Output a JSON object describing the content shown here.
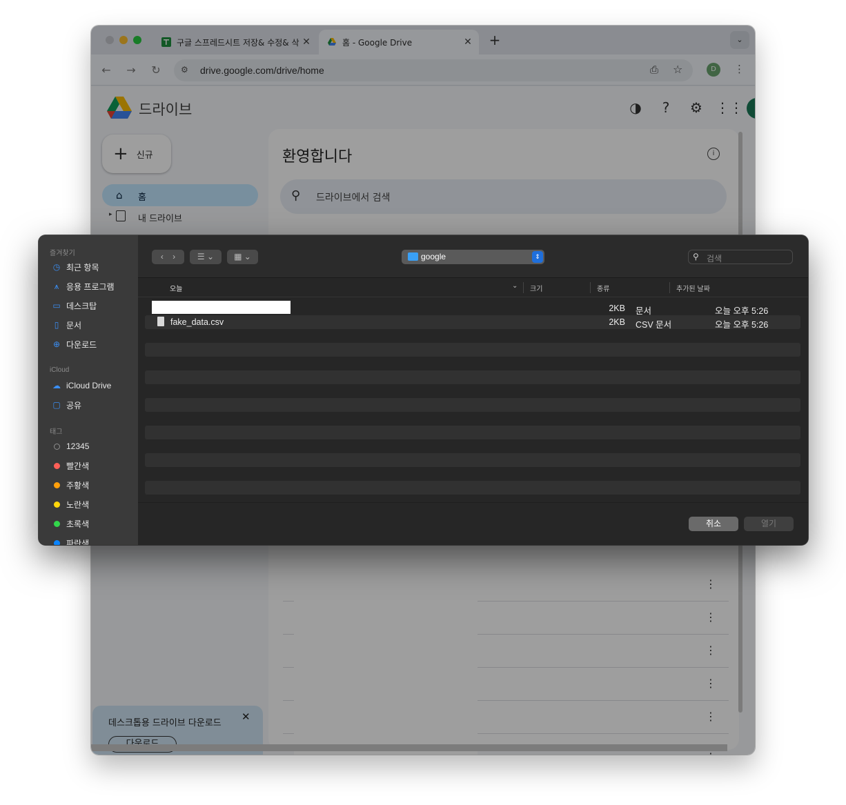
{
  "browser": {
    "tabs": [
      {
        "title": "구글 스프레드시트 저장& 수정& 삭"
      },
      {
        "title": "홈 - Google Drive"
      }
    ],
    "new_tab": "+",
    "url": "drive.google.com/drive/home",
    "profile_initial": "D"
  },
  "drive": {
    "app_name": "드라이브",
    "new_button": "신규",
    "nav": [
      {
        "label": "홈"
      },
      {
        "label": "내 드라이브"
      }
    ],
    "welcome": "환영합니다",
    "search_placeholder": "드라이브에서 검색",
    "promo_title": "데스크톱용 드라이브 다운로드",
    "promo_button": "다운로드"
  },
  "dialog": {
    "sidebar": {
      "favorites_header": "즐겨찾기",
      "favorites": [
        {
          "label": "최근 항목",
          "icon": "clock-icon"
        },
        {
          "label": "응용 프로그램",
          "icon": "apps-icon"
        },
        {
          "label": "데스크탑",
          "icon": "desktop-icon"
        },
        {
          "label": "문서",
          "icon": "document-icon"
        },
        {
          "label": "다운로드",
          "icon": "download-icon"
        }
      ],
      "icloud_header": "iCloud",
      "icloud": [
        {
          "label": "iCloud Drive",
          "icon": "cloud-icon"
        },
        {
          "label": "공유",
          "icon": "shared-folder-icon"
        }
      ],
      "tags_header": "태그",
      "tags": [
        {
          "label": "12345",
          "color": "#8e8e8e"
        },
        {
          "label": "빨간색",
          "color": "#ff5f57"
        },
        {
          "label": "주황색",
          "color": "#ff9f0a"
        },
        {
          "label": "노란색",
          "color": "#ffd60a"
        },
        {
          "label": "초록색",
          "color": "#32d74b"
        },
        {
          "label": "파란색",
          "color": "#0a84ff"
        }
      ]
    },
    "location": "google",
    "search_placeholder": "검색",
    "columns": {
      "name": "오늘",
      "size": "크기",
      "kind": "종류",
      "date": "추가된 날짜"
    },
    "files": [
      {
        "name": "",
        "size": "2KB",
        "kind": "문서",
        "date": "오늘 오후 5:26"
      },
      {
        "name": "fake_data.csv",
        "size": "2KB",
        "kind": "CSV 문서",
        "date": "오늘 오후 5:26"
      }
    ],
    "cancel": "취소",
    "open": "열기"
  }
}
